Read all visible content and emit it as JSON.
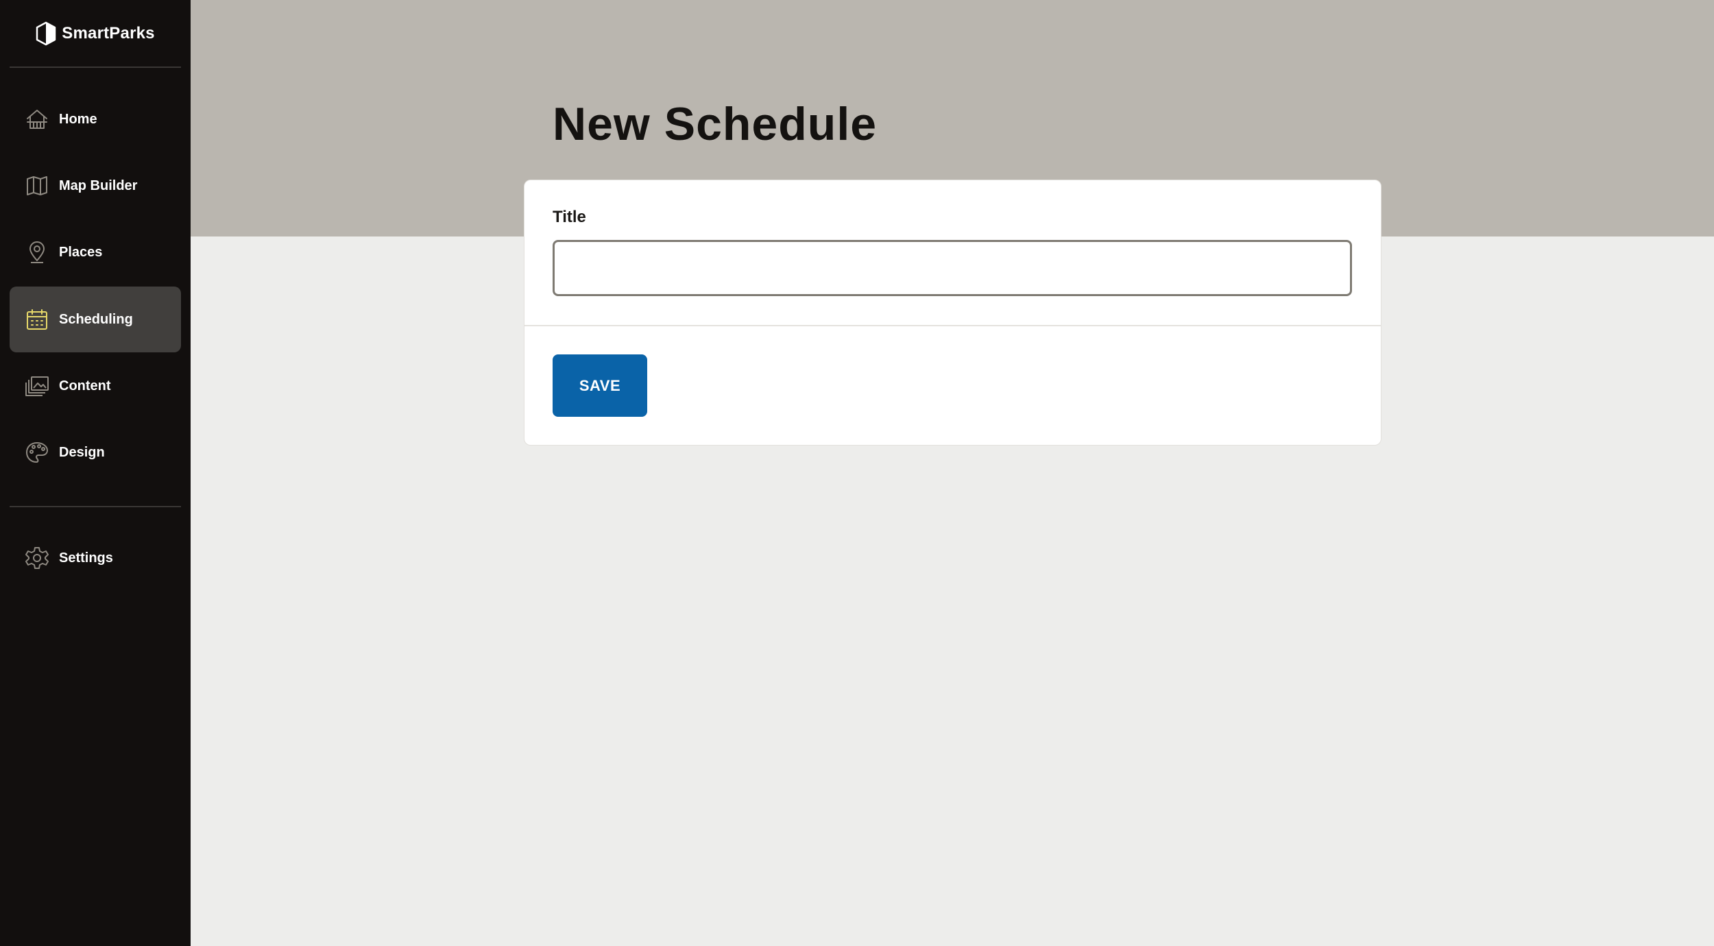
{
  "app": {
    "brand_name": "SmartParks"
  },
  "sidebar": {
    "items": [
      {
        "label": "Home",
        "icon": "home-icon",
        "active": false
      },
      {
        "label": "Map Builder",
        "icon": "map-icon",
        "active": false
      },
      {
        "label": "Places",
        "icon": "map-pin-icon",
        "active": false
      },
      {
        "label": "Scheduling",
        "icon": "calendar-icon",
        "active": true
      },
      {
        "label": "Content",
        "icon": "image-gallery-icon",
        "active": false
      },
      {
        "label": "Design",
        "icon": "palette-icon",
        "active": false
      }
    ],
    "settings": {
      "label": "Settings",
      "icon": "gear-icon"
    }
  },
  "main": {
    "page_title": "New Schedule",
    "form": {
      "title_label": "Title",
      "title_value": "",
      "title_placeholder": "",
      "save_label": "SAVE"
    }
  },
  "colors": {
    "sidebar_bg": "#120f0e",
    "active_item_bg": "#413f3d",
    "active_icon": "#e8d96a",
    "header_bg": "#bab6af",
    "content_bg": "#ededeb",
    "save_button": "#0a63a8"
  }
}
